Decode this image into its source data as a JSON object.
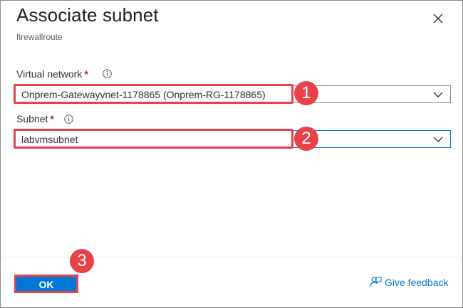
{
  "dialog": {
    "title": "Associate subnet",
    "subtitle": "firewallroute"
  },
  "fields": {
    "virtual_network": {
      "label": "Virtual network",
      "required_mark": "*",
      "value": "Onprem-Gatewayvnet-1178865 (Onprem-RG-1178865)"
    },
    "subnet": {
      "label": "Subnet",
      "required_mark": "*",
      "value": "labvmsubnet"
    }
  },
  "callouts": [
    "1",
    "2",
    "3"
  ],
  "footer": {
    "ok_label": "OK",
    "feedback_label": "Give feedback"
  },
  "colors": {
    "accent": "#0078d4",
    "callout": "#e8414a",
    "required": "#a4262c"
  },
  "icons": {
    "close": "close-icon",
    "info": "info-icon",
    "chevron": "chevron-down-icon",
    "feedback": "feedback-icon"
  }
}
